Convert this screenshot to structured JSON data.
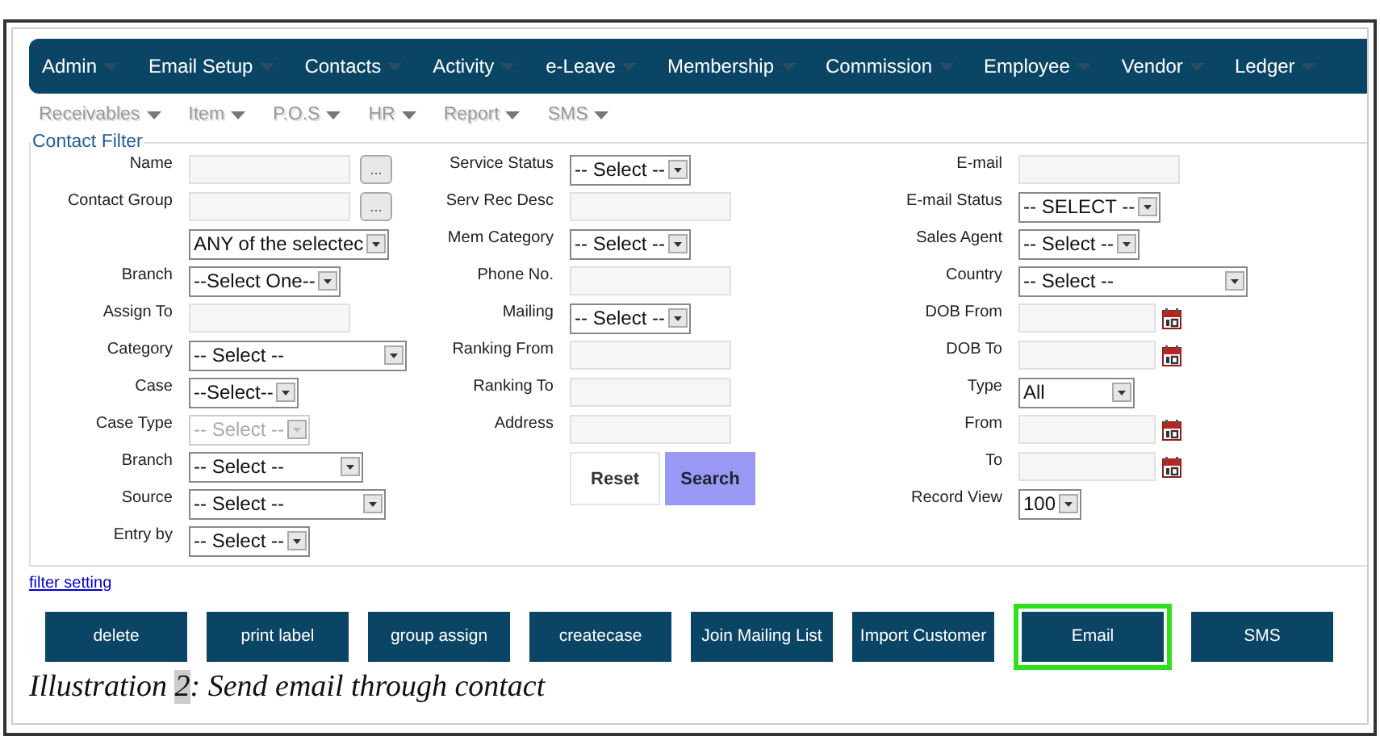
{
  "menu": [
    {
      "label": "Admin"
    },
    {
      "label": "Email Setup"
    },
    {
      "label": "Contacts"
    },
    {
      "label": "Activity"
    },
    {
      "label": "e-Leave"
    },
    {
      "label": "Membership"
    },
    {
      "label": "Commission"
    },
    {
      "label": "Employee"
    },
    {
      "label": "Vendor"
    },
    {
      "label": "Ledger"
    }
  ],
  "submenu": [
    {
      "label": "Receivables"
    },
    {
      "label": "Item"
    },
    {
      "label": "P.O.S"
    },
    {
      "label": "HR"
    },
    {
      "label": "Report"
    },
    {
      "label": "SMS"
    }
  ],
  "filter": {
    "title": "Contact Filter",
    "columns": [
      [
        {
          "label": "Name",
          "kind": "lookup",
          "button": "..."
        },
        {
          "label": "Contact Group",
          "kind": "lookup",
          "button": "..."
        },
        {
          "kind": "select",
          "value": "ANY of the selectec",
          "disabled": false
        },
        {
          "label": "Branch",
          "kind": "select",
          "value": "--Select One--",
          "disabled": false
        },
        {
          "label": "Assign To",
          "kind": "text"
        },
        {
          "label": "Category",
          "kind": "select",
          "value": "-- Select --                  ",
          "disabled": false
        },
        {
          "label": "Case",
          "kind": "select",
          "value": "--Select--",
          "disabled": false
        },
        {
          "label": "Case Type",
          "kind": "select",
          "value": "-- Select --",
          "disabled": true
        },
        {
          "label": "Branch",
          "kind": "select",
          "value": "-- Select --          ",
          "disabled": false
        },
        {
          "label": "Source",
          "kind": "select",
          "value": "-- Select --              ",
          "disabled": false
        },
        {
          "label": "Entry by",
          "kind": "select",
          "value": "-- Select --",
          "disabled": false
        }
      ],
      [
        {
          "label": "Service Status",
          "kind": "select",
          "value": "-- Select --",
          "disabled": false
        },
        {
          "label": "Serv Rec Desc",
          "kind": "text"
        },
        {
          "label": "Mem Category",
          "kind": "select",
          "value": "-- Select --",
          "disabled": false
        },
        {
          "label": "Phone No.",
          "kind": "text"
        },
        {
          "label": "Mailing",
          "kind": "select",
          "value": "-- Select --",
          "disabled": false
        },
        {
          "label": "Ranking From",
          "kind": "text"
        },
        {
          "label": "Ranking To",
          "kind": "text"
        },
        {
          "label": "Address",
          "kind": "text"
        }
      ],
      [
        {
          "label": "E-mail",
          "kind": "text"
        },
        {
          "label": "E-mail Status",
          "kind": "select",
          "value": "-- SELECT --",
          "disabled": false
        },
        {
          "label": "Sales Agent",
          "kind": "select",
          "value": "-- Select --",
          "disabled": false
        },
        {
          "label": "Country",
          "kind": "select",
          "value": "-- Select --                    ",
          "disabled": false
        },
        {
          "label": "DOB From",
          "kind": "date"
        },
        {
          "label": "DOB To",
          "kind": "date"
        },
        {
          "label": "Type",
          "kind": "select",
          "value": "All            ",
          "disabled": false
        },
        {
          "label": "From",
          "kind": "date"
        },
        {
          "label": "To",
          "kind": "date"
        },
        {
          "label": "Record View",
          "kind": "select",
          "value": "100",
          "disabled": false
        }
      ]
    ],
    "actions": [
      {
        "label": "Reset",
        "kind": "reset"
      },
      {
        "label": "Search",
        "kind": "submit"
      }
    ]
  },
  "filter_setting": "filter setting",
  "buttons": [
    {
      "label": "delete",
      "highlighted": false
    },
    {
      "label": "print label",
      "highlighted": false
    },
    {
      "label": "group assign",
      "highlighted": false
    },
    {
      "label": "createcase",
      "highlighted": false
    },
    {
      "label": "Join Mailing List",
      "highlighted": false
    },
    {
      "label": "Import Customer",
      "highlighted": false
    },
    {
      "label": "Email",
      "highlighted": true
    },
    {
      "label": "SMS",
      "highlighted": false
    }
  ],
  "caption": {
    "label": "Illustration",
    "number": "2",
    "text": ": Send email through contact"
  }
}
